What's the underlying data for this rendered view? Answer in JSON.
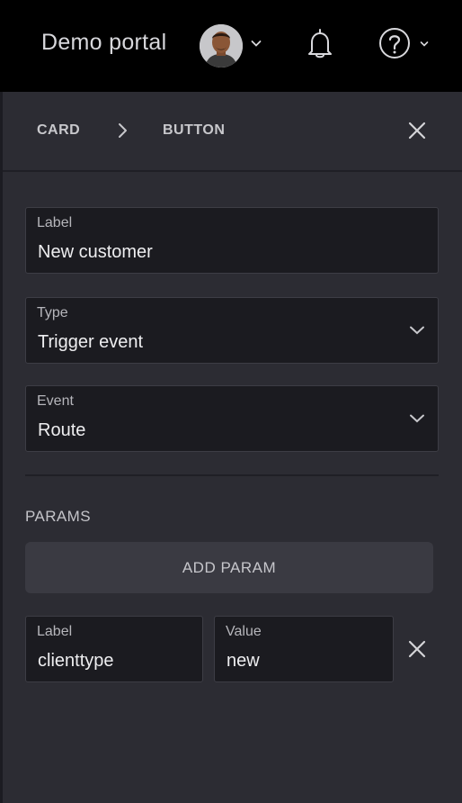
{
  "header": {
    "portal_title": "Demo portal",
    "avatar_icon": "user-avatar",
    "bell_icon": "bell-icon",
    "help_icon": "help-icon"
  },
  "panel": {
    "breadcrumb": {
      "first": "CARD",
      "second": "BUTTON"
    },
    "close_icon": "close-icon",
    "fields": {
      "label": {
        "label": "Label",
        "value": "New customer"
      },
      "type": {
        "label": "Type",
        "value": "Trigger event"
      },
      "event": {
        "label": "Event",
        "value": "Route"
      }
    },
    "params": {
      "title": "PARAMS",
      "add_label": "ADD PARAM",
      "row": {
        "label_field": {
          "label": "Label",
          "value": "clienttype"
        },
        "value_field": {
          "label": "Value",
          "value": "new"
        }
      }
    }
  },
  "colors": {
    "topbar": "#000000",
    "panel": "#2c2c33",
    "field": "#1b1b20",
    "button": "#3a3a42"
  }
}
